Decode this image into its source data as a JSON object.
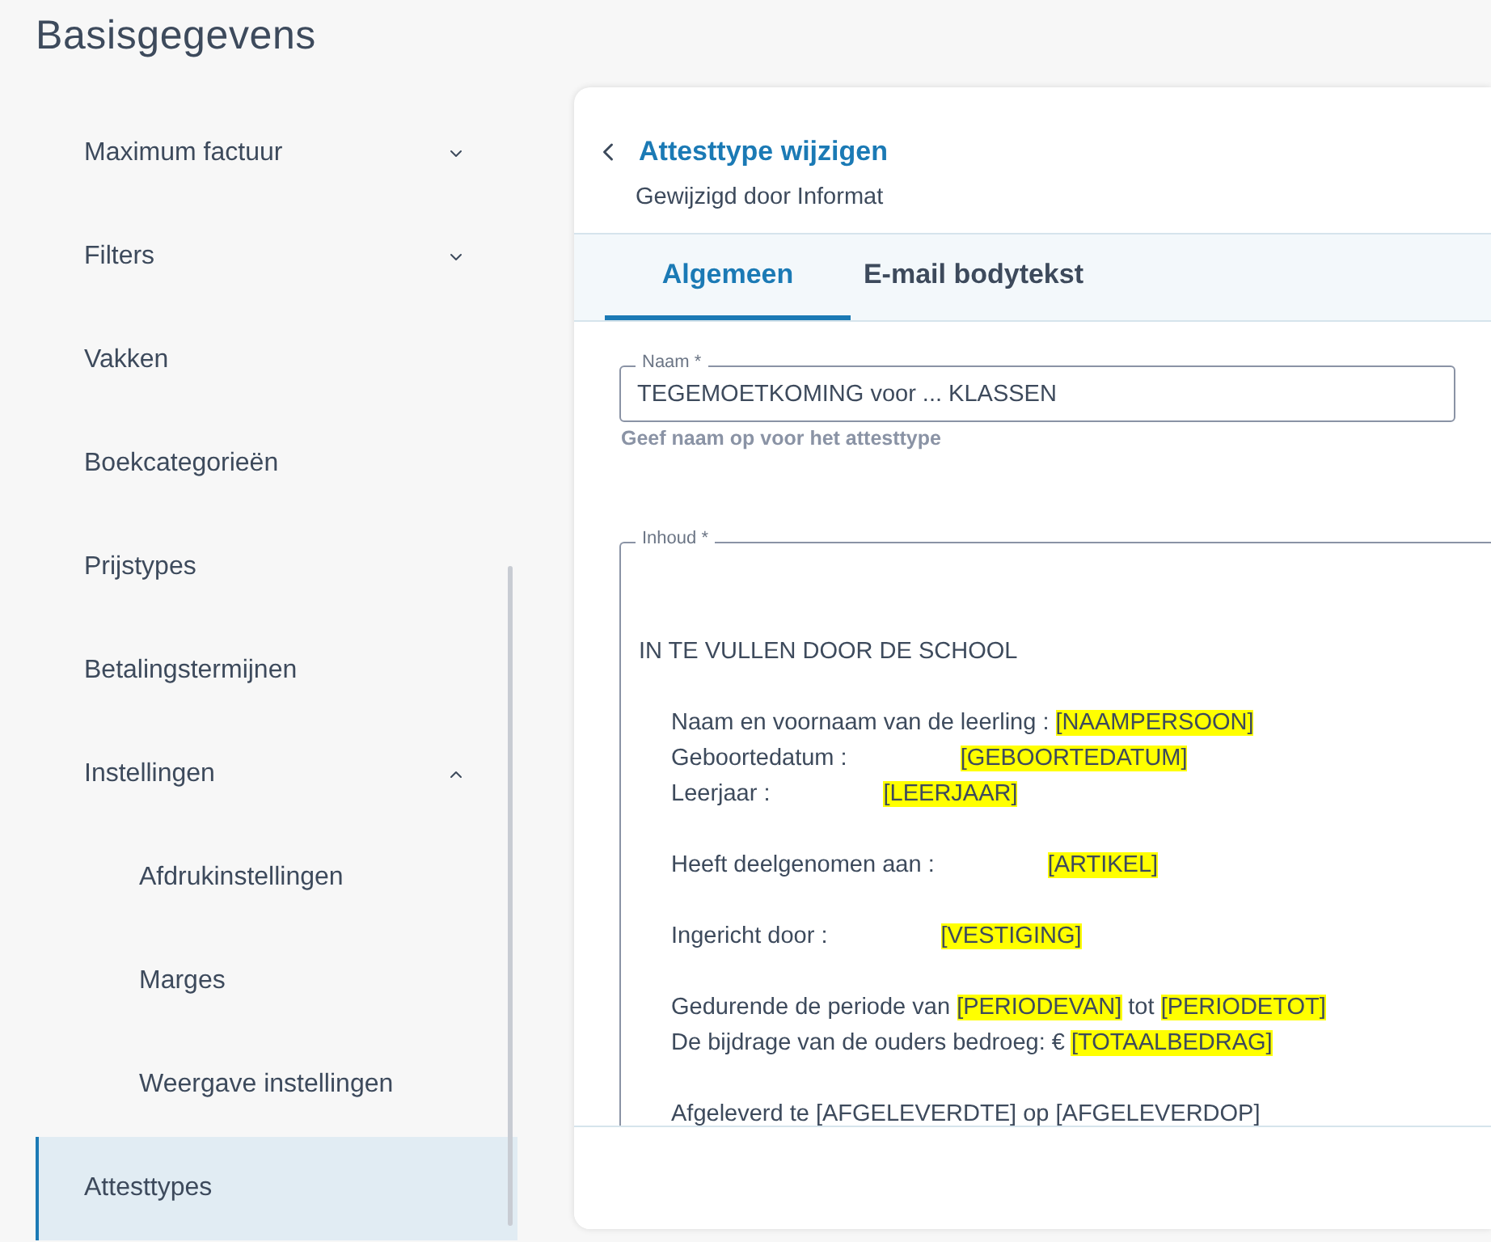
{
  "page_title": "Basisgegevens",
  "sidebar": {
    "items": [
      {
        "label": "Maximum factuur",
        "expandable": true,
        "expanded": false,
        "selected": false
      },
      {
        "label": "Filters",
        "expandable": true,
        "expanded": false,
        "selected": false
      },
      {
        "label": "Vakken",
        "expandable": false,
        "selected": false
      },
      {
        "label": "Boekcategorieën",
        "expandable": false,
        "selected": false
      },
      {
        "label": "Prijstypes",
        "expandable": false,
        "selected": false
      },
      {
        "label": "Betalingstermijnen",
        "expandable": false,
        "selected": false
      },
      {
        "label": "Instellingen",
        "expandable": true,
        "expanded": true,
        "selected": false,
        "children": [
          {
            "label": "Afdrukinstellingen",
            "selected": false
          },
          {
            "label": "Marges",
            "selected": false
          },
          {
            "label": "Weergave instellingen",
            "selected": false
          }
        ]
      },
      {
        "label": "Attesttypes",
        "expandable": false,
        "selected": true
      }
    ]
  },
  "panel": {
    "title": "Attesttype wijzigen",
    "subtitle": "Gewijzigd door Informat",
    "tabs": [
      {
        "label": "Algemeen",
        "selected": true
      },
      {
        "label": "E-mail bodytekst",
        "selected": false
      }
    ],
    "name_field": {
      "label": "Naam *",
      "value": "TEGEMOETKOMING voor ... KLASSEN",
      "helper": "Geef naam op voor het attesttype"
    },
    "content_field": {
      "label": "Inhoud *",
      "lines": [
        {
          "kind": "heading",
          "segments": [
            {
              "text": "IN TE VULLEN DOOR DE SCHOOL",
              "highlight": false
            }
          ]
        },
        {
          "kind": "line",
          "space_before": true,
          "segments": [
            {
              "text": "Naam en voornaam van de leerling :",
              "highlight": false
            },
            {
              "text": "[NAAMPERSOON]",
              "highlight": true,
              "tabbed": false
            }
          ]
        },
        {
          "kind": "line",
          "space_before": false,
          "segments": [
            {
              "text": "Geboortedatum :",
              "highlight": false
            },
            {
              "text": "[GEBOORTEDATUM]",
              "highlight": true,
              "tabbed": true
            }
          ]
        },
        {
          "kind": "line",
          "space_before": false,
          "segments": [
            {
              "text": "Leerjaar :",
              "highlight": false
            },
            {
              "text": "[LEERJAAR]",
              "highlight": true,
              "tabbed": true
            }
          ]
        },
        {
          "kind": "line",
          "space_before": true,
          "segments": [
            {
              "text": "Heeft deelgenomen aan :",
              "highlight": false
            },
            {
              "text": "[ARTIKEL]",
              "highlight": true,
              "tabbed": true
            }
          ]
        },
        {
          "kind": "line",
          "space_before": true,
          "segments": [
            {
              "text": "Ingericht door :",
              "highlight": false
            },
            {
              "text": "[VESTIGING]",
              "highlight": true,
              "tabbed": true
            }
          ]
        },
        {
          "kind": "line",
          "space_before": true,
          "segments": [
            {
              "text": "Gedurende de periode van",
              "highlight": false
            },
            {
              "text": "[PERIODEVAN]",
              "highlight": true,
              "tabbed": false
            },
            {
              "text": "tot",
              "highlight": false
            },
            {
              "text": "[PERIODETOT]",
              "highlight": true,
              "tabbed": false
            }
          ]
        },
        {
          "kind": "line",
          "space_before": false,
          "segments": [
            {
              "text": "De bijdrage van de ouders bedroeg: €",
              "highlight": false
            },
            {
              "text": "[TOTAALBEDRAG]",
              "highlight": true,
              "tabbed": false
            }
          ]
        },
        {
          "kind": "line",
          "space_before": true,
          "segments": [
            {
              "text": "Afgeleverd te [AFGELEVERDTE] op [AFGELEVERDOP]",
              "highlight": false
            }
          ]
        }
      ]
    }
  }
}
